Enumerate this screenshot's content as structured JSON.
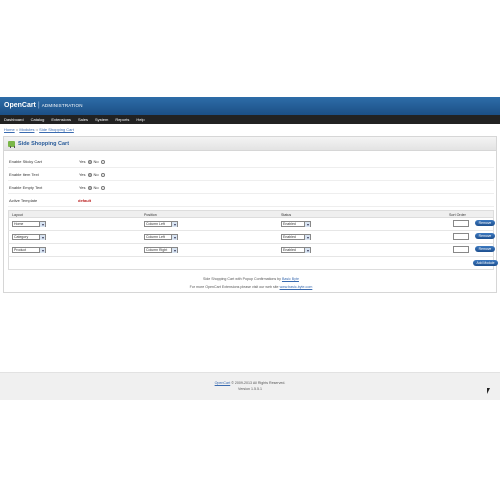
{
  "header": {
    "brand": "OpenCart",
    "separator": "|",
    "subtitle": "ADMINISTRATION"
  },
  "menu": [
    "Dashboard",
    "Catalog",
    "Extensions",
    "Sales",
    "System",
    "Reports",
    "Help"
  ],
  "breadcrumb": [
    "Home",
    "Modules",
    "Side Shopping Cart"
  ],
  "box": {
    "title": "Side Shopping Cart"
  },
  "settings": {
    "sticky": {
      "label": "Enable Sticky Cart",
      "yes": "Yes",
      "no": "No"
    },
    "item_text": {
      "label": "Enable Item Text",
      "yes": "Yes",
      "no": "No"
    },
    "empty_text": {
      "label": "Enable Empty Text",
      "yes": "Yes",
      "no": "No"
    },
    "template": {
      "label": "Active Template",
      "value": "default"
    }
  },
  "table": {
    "headers": {
      "layout": "Layout",
      "position": "Position",
      "status": "Status",
      "sort": "Sort Order"
    },
    "rows": [
      {
        "layout": "Home",
        "position": "Column Left",
        "status": "Enabled",
        "remove": "Remove"
      },
      {
        "layout": "Category",
        "position": "Column Left",
        "status": "Enabled",
        "remove": "Remove"
      },
      {
        "layout": "Product",
        "position": "Column Right",
        "status": "Enabled",
        "remove": "Remove"
      }
    ],
    "add_label": "Add Module"
  },
  "notes": {
    "line1_pre": "Side Shopping Cart with Popup Confirmations by ",
    "line1_link": "Basic Byte",
    "line2_pre": "For more OpenCart Extensions please visit our web site ",
    "line2_link": "www.basic-byte.com"
  },
  "footer": {
    "link": "OpenCart",
    "copyright": " © 2009-2013 All Rights Reserved.",
    "version": "Version 1.5.5.1"
  },
  "colors": {
    "header_blue": "#1b4f86",
    "menu_dark": "#222222",
    "button_blue": "#2a64ab",
    "template_red": "#bb2222"
  }
}
